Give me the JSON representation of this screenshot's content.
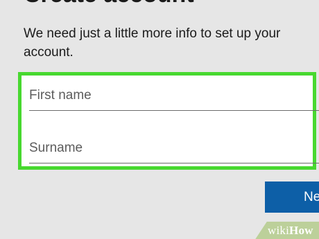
{
  "page": {
    "heading_partial": "Create account",
    "description": "We need just a little more info to set up your account."
  },
  "form": {
    "first_name_placeholder": "First name",
    "surname_placeholder": "Surname",
    "highlight_color": "#47d82f"
  },
  "actions": {
    "next_label": "Next",
    "next_color": "#0d5fa7"
  },
  "watermark": {
    "wiki": "wiki",
    "how": "How"
  }
}
